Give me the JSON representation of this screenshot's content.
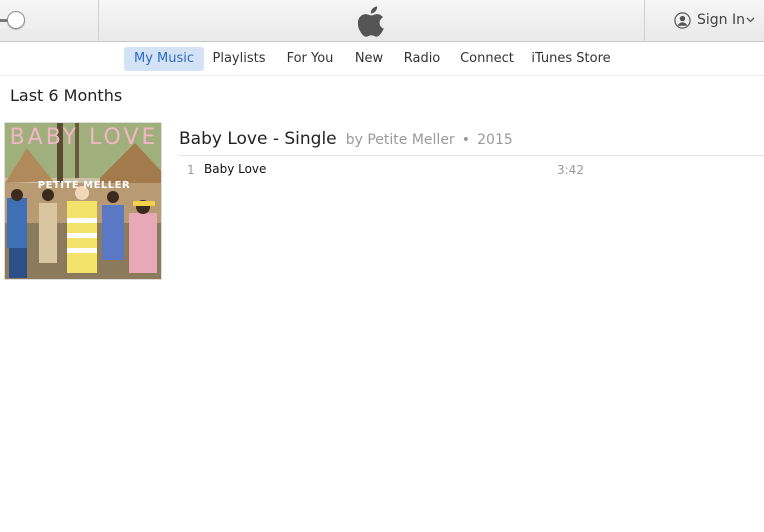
{
  "toolbar": {
    "account": {
      "label": "Sign In",
      "icon": "user-circle-icon"
    },
    "logo_icon": "apple-logo-icon",
    "volume_icon": "volume-slider"
  },
  "nav": {
    "tabs": [
      {
        "label": "My Music",
        "active": true
      },
      {
        "label": "Playlists",
        "active": false
      },
      {
        "label": "For You",
        "active": false
      },
      {
        "label": "New",
        "active": false
      },
      {
        "label": "Radio",
        "active": false
      },
      {
        "label": "Connect",
        "active": false
      },
      {
        "label": "iTunes Store",
        "active": false
      }
    ]
  },
  "main": {
    "section_title": "Last 6 Months",
    "album": {
      "title": "Baby Love - Single",
      "byline": "by Petite Meller",
      "year_sep": "•",
      "year": "2015",
      "art_title": "BABY LOVE",
      "art_artist": "PETITE MELLER",
      "tracks": [
        {
          "number": "1",
          "name": "Baby Love",
          "duration": "3:42"
        }
      ]
    }
  },
  "colors": {
    "accent": "#2b6cc4",
    "active_tab_bg": "#d3e2f5",
    "art_title_pink": "#f4b5c6"
  }
}
